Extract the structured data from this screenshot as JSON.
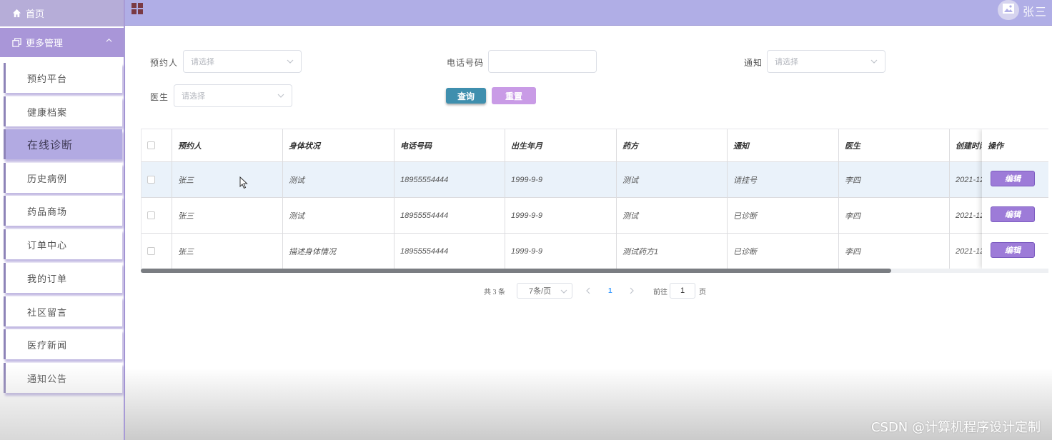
{
  "sidebar": {
    "home_label": "首页",
    "group_label": "更多管理",
    "items": [
      {
        "label": "预约平台",
        "active": false
      },
      {
        "label": "健康档案",
        "active": false
      },
      {
        "label": "在线诊断",
        "active": true
      },
      {
        "label": "历史病例",
        "active": false
      },
      {
        "label": "药品商场",
        "active": false
      },
      {
        "label": "订单中心",
        "active": false
      },
      {
        "label": "我的订单",
        "active": false
      },
      {
        "label": "社区留言",
        "active": false
      },
      {
        "label": "医疗新闻",
        "active": false
      },
      {
        "label": "通知公告",
        "active": false
      }
    ]
  },
  "header": {
    "username": "张三"
  },
  "filters": {
    "appointee_label": "预约人",
    "appointee_placeholder": "请选择",
    "phone_label": "电话号码",
    "phone_value": "",
    "notice_label": "通知",
    "notice_placeholder": "请选择",
    "doctor_label": "医生",
    "doctor_placeholder": "请选择",
    "search_button": "查询",
    "reset_button": "重置"
  },
  "table": {
    "headers": [
      "预约人",
      "身体状况",
      "电话号码",
      "出生年月",
      "药方",
      "通知",
      "医生",
      "创建时间",
      "操作"
    ],
    "rows": [
      {
        "name": "张三",
        "condition": "测试",
        "phone": "18955554444",
        "birth": "1999-9-9",
        "prescription": "测试",
        "notice": "请挂号",
        "doctor": "李四",
        "created": "2021-12",
        "highlight": true
      },
      {
        "name": "张三",
        "condition": "测试",
        "phone": "18955554444",
        "birth": "1999-9-9",
        "prescription": "测试",
        "notice": "已诊断",
        "doctor": "李四",
        "created": "2021-12",
        "highlight": false
      },
      {
        "name": "张三",
        "condition": "描述身体情况",
        "phone": "18955554444",
        "birth": "1999-9-9",
        "prescription": "测试药方1",
        "notice": "已诊断",
        "doctor": "李四",
        "created": "2021-12",
        "highlight": false
      }
    ],
    "edit_label": "编辑"
  },
  "pagination": {
    "total_text": "共 3 条",
    "page_size": "7条/页",
    "current_page": "1",
    "goto_label": "前往",
    "goto_value": "1",
    "page_suffix": "页"
  },
  "watermark": "CSDN @计算机程序设计定制",
  "colors": {
    "topbar": "#b0aee6",
    "sidebar_group": "#a996d8",
    "active_item": "#b2aae2",
    "search_button": "#3f8fae",
    "reset_button": "#c99be6",
    "edit_button": "#9d7bd8"
  }
}
